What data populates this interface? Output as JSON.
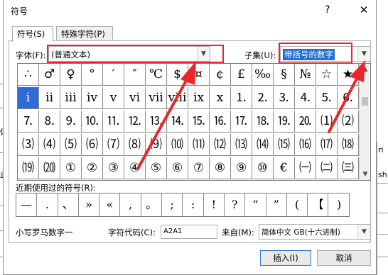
{
  "dialog": {
    "title": "符号",
    "help_glyph": "?",
    "close_glyph": "✕"
  },
  "tabs": [
    {
      "label": "符号(S)"
    },
    {
      "label": "特殊字符(P)"
    }
  ],
  "font": {
    "label": "字体(F):",
    "value": "(普通文本)"
  },
  "subset": {
    "label": "子集(U):",
    "value": "带括号的数字"
  },
  "symbol_rows": [
    [
      "∴",
      "♂",
      "♀",
      "°",
      "′",
      "″",
      "℃",
      "$",
      "¤",
      "¢",
      "£",
      "‰",
      "§",
      "№",
      "☆",
      "★"
    ],
    [
      "ⅰ",
      "ⅱ",
      "ⅲ",
      "ⅳ",
      "ⅴ",
      "ⅵ",
      "ⅶ",
      "ⅷ",
      "ⅸ",
      "ⅹ",
      "⒈",
      "⒉",
      "⒊",
      "⒋",
      "⒌",
      "⒍"
    ],
    [
      "⒎",
      "⒏",
      "⒐",
      "⒑",
      "⒒",
      "⒓",
      "⒔",
      "⒕",
      "⒖",
      "⒗",
      "⒘",
      "⒙",
      "⒚",
      "⒛",
      "⑴",
      "⑵"
    ],
    [
      "⑶",
      "⑷",
      "⑸",
      "⑹",
      "⑺",
      "⑻",
      "⑼",
      "⑽",
      "⑾",
      "⑿",
      "⒀",
      "⒁",
      "⒂",
      "⒃",
      "⒄",
      "⒅"
    ],
    [
      "⒆",
      "⒇",
      "①",
      "②",
      "③",
      "④",
      "⑤",
      "⑥",
      "⑦",
      "⑧",
      "⑨",
      "⑩",
      "€",
      "㈠",
      "㈡",
      "㈢"
    ]
  ],
  "selected_symbol": {
    "row": 1,
    "col": 0
  },
  "recent": {
    "label": "近期使用过的符号(R):",
    "symbols": [
      "—",
      ".",
      "、",
      "»",
      "«",
      ",",
      "。",
      ";",
      ":",
      "!",
      "?",
      "“",
      "”",
      "(",
      "【",
      ")"
    ]
  },
  "char_name": "小写罗马数字一",
  "char_code": {
    "label": "字符代码(C):",
    "value": "A2A1"
  },
  "from": {
    "label": "来自(M):",
    "value": "简体中文 GB(十六进制)"
  },
  "buttons": {
    "insert": "插入(I)",
    "cancel": "取消"
  },
  "background_sheet": {
    "left_glyph_1": "体",
    "left_glyph_2": "业",
    "right_glyph_1": "ri",
    "right_glyph_2": "sh"
  },
  "annotation_color": "#e8262b",
  "selection_color": "#2f6bd6"
}
